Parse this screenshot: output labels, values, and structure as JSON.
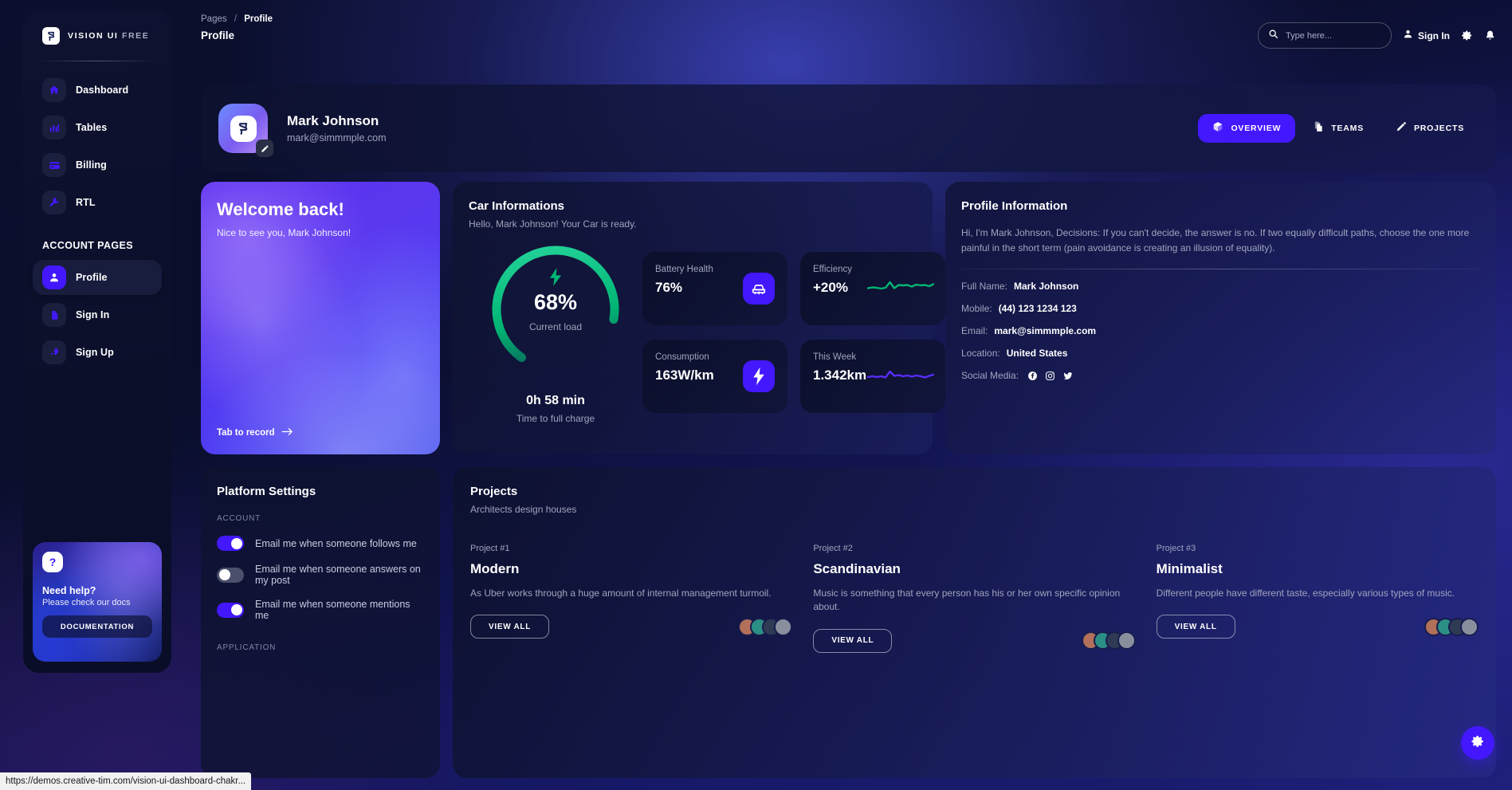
{
  "brand": {
    "logo_icon": "vision-logo-icon",
    "name_bold": "VISION UI ",
    "name_dim": "FREE"
  },
  "sidebar": {
    "items": [
      {
        "label": "Dashboard",
        "icon": "home-icon"
      },
      {
        "label": "Tables",
        "icon": "bar-chart-icon"
      },
      {
        "label": "Billing",
        "icon": "credit-card-icon"
      },
      {
        "label": "RTL",
        "icon": "wrench-icon"
      }
    ],
    "section_label": "ACCOUNT PAGES",
    "account_items": [
      {
        "label": "Profile",
        "icon": "person-icon",
        "active": true
      },
      {
        "label": "Sign In",
        "icon": "document-icon",
        "active": false
      },
      {
        "label": "Sign Up",
        "icon": "rocket-icon",
        "active": false
      }
    ],
    "help": {
      "badge_icon": "question-mark-icon",
      "title": "Need help?",
      "subtitle": "Please check our docs",
      "button_label": "DOCUMENTATION"
    }
  },
  "topbar": {
    "breadcrumb_root": "Pages",
    "breadcrumb_sep": "/",
    "breadcrumb_current": "Profile",
    "page_title": "Profile",
    "search": {
      "placeholder": "Type here...",
      "value": "",
      "icon": "search-icon"
    },
    "signin_label": "Sign In",
    "signin_icon": "person-icon",
    "settings_icon": "gear-icon",
    "bell_icon": "bell-icon"
  },
  "profile_header": {
    "name": "Mark Johnson",
    "email": "mark@simmmple.com",
    "avatar_icon": "vision-logo-icon",
    "edit_icon": "pencil-icon",
    "tabs": [
      {
        "label": "OVERVIEW",
        "icon": "cube-icon",
        "active": true
      },
      {
        "label": "TEAMS",
        "icon": "documents-icon",
        "active": false
      },
      {
        "label": "PROJECTS",
        "icon": "pen-icon",
        "active": false
      }
    ]
  },
  "welcome": {
    "title": "Welcome back!",
    "subtitle": "Nice to see you, Mark Johnson!",
    "link_label": "Tab to record",
    "link_icon": "arrow-right-icon"
  },
  "car": {
    "title": "Car Informations",
    "subtitle": "Hello, Mark Johnson! Your Car is ready.",
    "gauge": {
      "percent": 68,
      "value_label": "68%",
      "caption": "Current load",
      "icon": "lightning-bolt-icon",
      "time": "0h 58 min",
      "time_label": "Time to full charge",
      "track_color": "#141a3d",
      "arc_color": "#01b574"
    },
    "stats": [
      {
        "label": "Battery Health",
        "value": "76%",
        "icon": "car-icon",
        "kind": "icon"
      },
      {
        "label": "Efficiency",
        "value": "+20%",
        "icon": "line-spark-green",
        "kind": "spark",
        "color": "#01b574"
      },
      {
        "label": "Consumption",
        "value": "163W/km",
        "icon": "lightning-bolt-icon",
        "kind": "icon"
      },
      {
        "label": "This Week",
        "value": "1.342km",
        "icon": "line-spark-purple",
        "kind": "spark",
        "color": "#582cff"
      }
    ]
  },
  "profile_information": {
    "title": "Profile Information",
    "description": "Hi, I'm Mark Johnson, Decisions: If you can't decide, the answer is no. If two equally difficult paths, choose the one more painful in the short term (pain avoidance is creating an illusion of equality).",
    "rows": [
      {
        "key": "Full Name:",
        "value": "Mark Johnson"
      },
      {
        "key": "Mobile:",
        "value": "(44) 123 1234 123"
      },
      {
        "key": "Email:",
        "value": "mark@simmmple.com"
      },
      {
        "key": "Location:",
        "value": "United States"
      }
    ],
    "social_key": "Social Media:",
    "social_icons": [
      "facebook-icon",
      "instagram-icon",
      "twitter-icon"
    ]
  },
  "platform_settings": {
    "title": "Platform Settings",
    "account_label": "ACCOUNT",
    "application_label": "APPLICATION",
    "toggles": [
      {
        "label": "Email me when someone follows me",
        "on": true
      },
      {
        "label": "Email me when someone answers on my post",
        "on": false
      },
      {
        "label": "Email me when someone mentions me",
        "on": true
      }
    ]
  },
  "projects": {
    "title": "Projects",
    "subtitle": "Architects design houses",
    "items": [
      {
        "number": "Project #1",
        "name": "Modern",
        "description": "As Uber works through a huge amount of internal management turmoil.",
        "button_label": "VIEW ALL",
        "avatar_colors": [
          "#b2705a",
          "#2c8f85",
          "#2f3b55",
          "#8a8f9e"
        ]
      },
      {
        "number": "Project #2",
        "name": "Scandinavian",
        "description": "Music is something that every person has his or her own specific opinion about.",
        "button_label": "VIEW ALL",
        "avatar_colors": [
          "#b2705a",
          "#2c8f85",
          "#2f3b55",
          "#8a8f9e"
        ]
      },
      {
        "number": "Project #3",
        "name": "Minimalist",
        "description": "Different people have different taste, especially various types of music.",
        "button_label": "VIEW ALL",
        "avatar_colors": [
          "#b2705a",
          "#2c8f85",
          "#2f3b55",
          "#8a8f9e"
        ]
      }
    ]
  },
  "fab": {
    "icon": "gear-icon"
  },
  "statusbar": {
    "url": "https://demos.creative-tim.com/vision-ui-dashboard-chakr..."
  },
  "chart_data": {
    "type": "line",
    "title": "Car Informations sparklines",
    "series": [
      {
        "name": "Efficiency",
        "color": "#01b574",
        "values": [
          22,
          20,
          21,
          19,
          20,
          12,
          22,
          16,
          17,
          16,
          19,
          14,
          16,
          15,
          13,
          16
        ]
      },
      {
        "name": "This Week",
        "color": "#582cff",
        "values": [
          20,
          21,
          19,
          20,
          17,
          8,
          16,
          17,
          15,
          16,
          14,
          16,
          15,
          12,
          14,
          11
        ]
      }
    ],
    "grid": false,
    "legend": "none"
  }
}
